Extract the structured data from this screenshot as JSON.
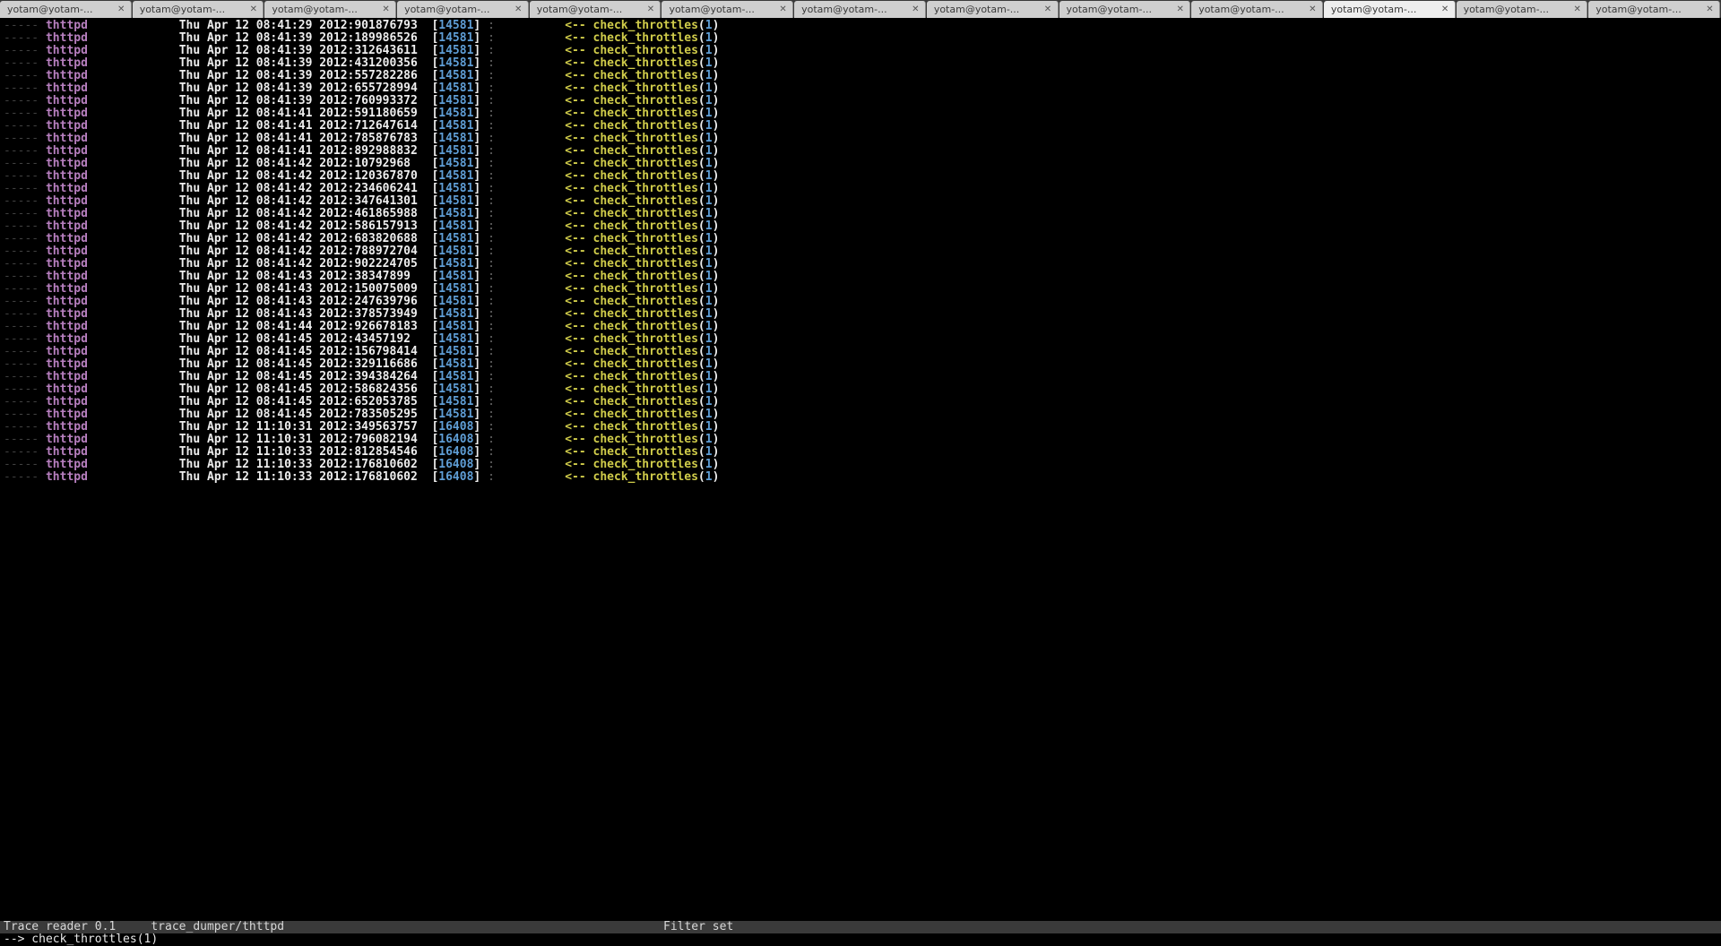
{
  "tabs": {
    "label": "yotam@yotam-...",
    "count": 13,
    "activeIndex": 10
  },
  "trace": {
    "dashes": "-----",
    "process": "thttpd",
    "arrow": "<--",
    "func": "check_throttles",
    "arg": "1",
    "rows": [
      {
        "ts": "Thu Apr 12 08:41:29 2012:901876793",
        "pid": "14581"
      },
      {
        "ts": "Thu Apr 12 08:41:39 2012:189986526",
        "pid": "14581"
      },
      {
        "ts": "Thu Apr 12 08:41:39 2012:312643611",
        "pid": "14581"
      },
      {
        "ts": "Thu Apr 12 08:41:39 2012:431200356",
        "pid": "14581"
      },
      {
        "ts": "Thu Apr 12 08:41:39 2012:557282286",
        "pid": "14581"
      },
      {
        "ts": "Thu Apr 12 08:41:39 2012:655728994",
        "pid": "14581"
      },
      {
        "ts": "Thu Apr 12 08:41:39 2012:760993372",
        "pid": "14581"
      },
      {
        "ts": "Thu Apr 12 08:41:41 2012:591180659",
        "pid": "14581"
      },
      {
        "ts": "Thu Apr 12 08:41:41 2012:712647614",
        "pid": "14581"
      },
      {
        "ts": "Thu Apr 12 08:41:41 2012:785876783",
        "pid": "14581"
      },
      {
        "ts": "Thu Apr 12 08:41:41 2012:892988832",
        "pid": "14581"
      },
      {
        "ts": "Thu Apr 12 08:41:42 2012:10792968",
        "pid": "14581"
      },
      {
        "ts": "Thu Apr 12 08:41:42 2012:120367870",
        "pid": "14581"
      },
      {
        "ts": "Thu Apr 12 08:41:42 2012:234606241",
        "pid": "14581"
      },
      {
        "ts": "Thu Apr 12 08:41:42 2012:347641301",
        "pid": "14581"
      },
      {
        "ts": "Thu Apr 12 08:41:42 2012:461865988",
        "pid": "14581"
      },
      {
        "ts": "Thu Apr 12 08:41:42 2012:586157913",
        "pid": "14581"
      },
      {
        "ts": "Thu Apr 12 08:41:42 2012:683820688",
        "pid": "14581"
      },
      {
        "ts": "Thu Apr 12 08:41:42 2012:788972704",
        "pid": "14581"
      },
      {
        "ts": "Thu Apr 12 08:41:42 2012:902224705",
        "pid": "14581"
      },
      {
        "ts": "Thu Apr 12 08:41:43 2012:38347899",
        "pid": "14581"
      },
      {
        "ts": "Thu Apr 12 08:41:43 2012:150075009",
        "pid": "14581"
      },
      {
        "ts": "Thu Apr 12 08:41:43 2012:247639796",
        "pid": "14581"
      },
      {
        "ts": "Thu Apr 12 08:41:43 2012:378573949",
        "pid": "14581"
      },
      {
        "ts": "Thu Apr 12 08:41:44 2012:926678183",
        "pid": "14581"
      },
      {
        "ts": "Thu Apr 12 08:41:45 2012:43457192",
        "pid": "14581"
      },
      {
        "ts": "Thu Apr 12 08:41:45 2012:156798414",
        "pid": "14581"
      },
      {
        "ts": "Thu Apr 12 08:41:45 2012:329116686",
        "pid": "14581"
      },
      {
        "ts": "Thu Apr 12 08:41:45 2012:394384264",
        "pid": "14581"
      },
      {
        "ts": "Thu Apr 12 08:41:45 2012:586824356",
        "pid": "14581"
      },
      {
        "ts": "Thu Apr 12 08:41:45 2012:652053785",
        "pid": "14581"
      },
      {
        "ts": "Thu Apr 12 08:41:45 2012:783505295",
        "pid": "14581"
      },
      {
        "ts": "Thu Apr 12 11:10:31 2012:349563757",
        "pid": "16408"
      },
      {
        "ts": "Thu Apr 12 11:10:31 2012:796082194",
        "pid": "16408"
      },
      {
        "ts": "Thu Apr 12 11:10:33 2012:812854546",
        "pid": "16408"
      },
      {
        "ts": "Thu Apr 12 11:10:33 2012:176810602",
        "pid": "16408"
      },
      {
        "ts": "Thu Apr 12 11:10:33 2012:176810602",
        "pid": "16408"
      }
    ]
  },
  "status": {
    "left": "Trace reader 0.1     trace_dumper/thttpd",
    "right": "Filter set"
  },
  "cmdline": "--> check_throttles(1)"
}
